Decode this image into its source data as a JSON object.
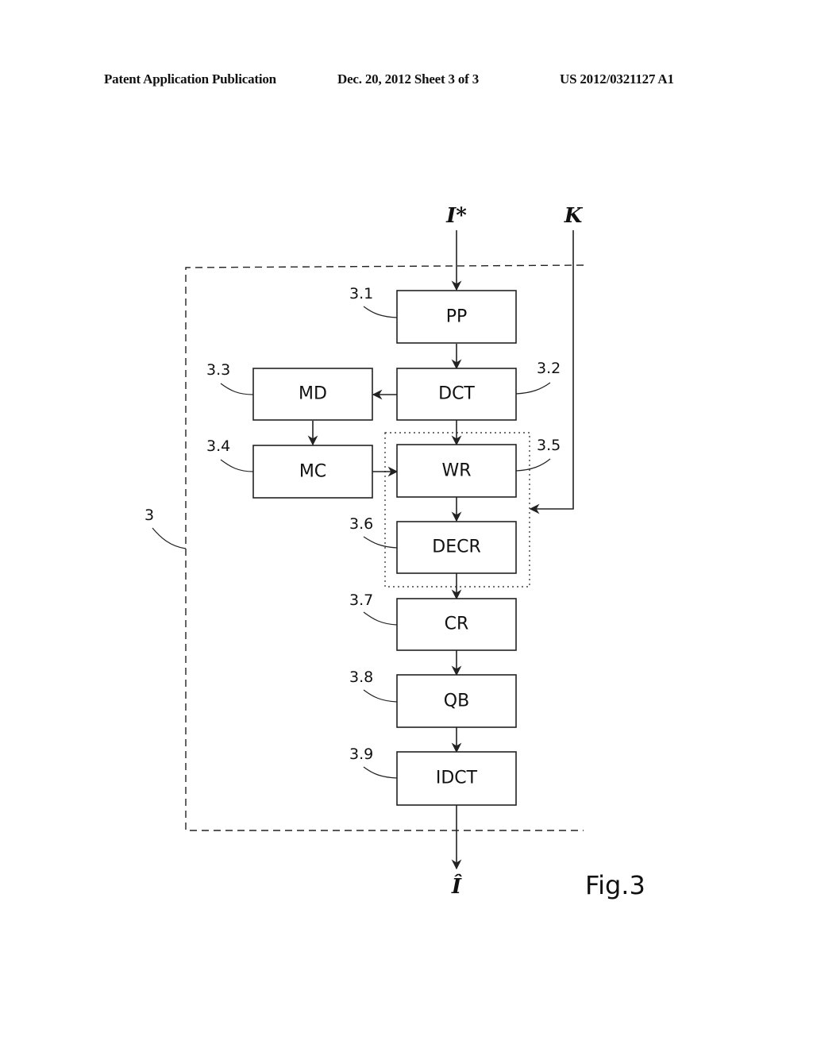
{
  "header": {
    "left": "Patent Application Publication",
    "middle": "Dec. 20, 2012   Sheet 3 of 3",
    "right": "US 2012/0321127 A1"
  },
  "figure": {
    "label": "Fig.3",
    "system_ref": "3",
    "inputs": {
      "image": "I*",
      "key": "K"
    },
    "output": "Î",
    "blocks": [
      {
        "id": "pp",
        "label": "PP",
        "ref": "3.1"
      },
      {
        "id": "dct",
        "label": "DCT",
        "ref": "3.2"
      },
      {
        "id": "md",
        "label": "MD",
        "ref": "3.3"
      },
      {
        "id": "mc",
        "label": "MC",
        "ref": "3.4"
      },
      {
        "id": "wr",
        "label": "WR",
        "ref": "3.5"
      },
      {
        "id": "decr",
        "label": "DECR",
        "ref": "3.6"
      },
      {
        "id": "cr",
        "label": "CR",
        "ref": "3.7"
      },
      {
        "id": "qb",
        "label": "QB",
        "ref": "3.8"
      },
      {
        "id": "idct",
        "label": "IDCT",
        "ref": "3.9"
      }
    ],
    "connections": [
      {
        "from": "I*",
        "to": "pp"
      },
      {
        "from": "pp",
        "to": "dct"
      },
      {
        "from": "dct",
        "to": "md"
      },
      {
        "from": "md",
        "to": "mc"
      },
      {
        "from": "mc",
        "to": "wr"
      },
      {
        "from": "dct",
        "to": "wr"
      },
      {
        "from": "K",
        "to": "3.5/3.6 group"
      },
      {
        "from": "wr",
        "to": "decr"
      },
      {
        "from": "decr",
        "to": "cr"
      },
      {
        "from": "cr",
        "to": "qb"
      },
      {
        "from": "qb",
        "to": "idct"
      },
      {
        "from": "idct",
        "to": "Î"
      }
    ]
  }
}
